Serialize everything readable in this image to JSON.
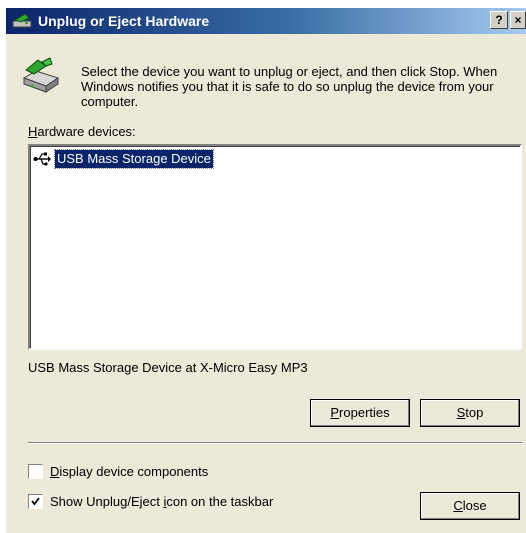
{
  "window": {
    "title": "Unplug or Eject Hardware",
    "help_button": "?",
    "close_button": "×"
  },
  "instructions": "Select the device you want to unplug or eject, and then click Stop. When Windows notifies you that it is safe to do so unplug the device from your computer.",
  "hardware_devices": {
    "label_accel": "H",
    "label_rest": "ardware devices:",
    "items": [
      {
        "label": "USB Mass Storage Device",
        "selected": true,
        "icon": "usb-icon"
      }
    ]
  },
  "device_description": "USB Mass Storage Device at X-Micro Easy MP3",
  "buttons": {
    "properties_accel": "P",
    "properties_rest": "roperties",
    "stop_accel": "S",
    "stop_rest": "top",
    "close_accel": "C",
    "close_rest": "lose"
  },
  "options": {
    "display_components": {
      "label_accel": "D",
      "label_rest": "isplay device components",
      "checked": false
    },
    "show_icon": {
      "label_pre": "Show Unplug/Eject ",
      "label_accel": "i",
      "label_post": "con on the taskbar",
      "checked": true
    }
  },
  "colors": {
    "titlebar_start": "#0a246a",
    "titlebar_end": "#a6caf0",
    "selection": "#0a246a",
    "face": "#ece9d8"
  }
}
